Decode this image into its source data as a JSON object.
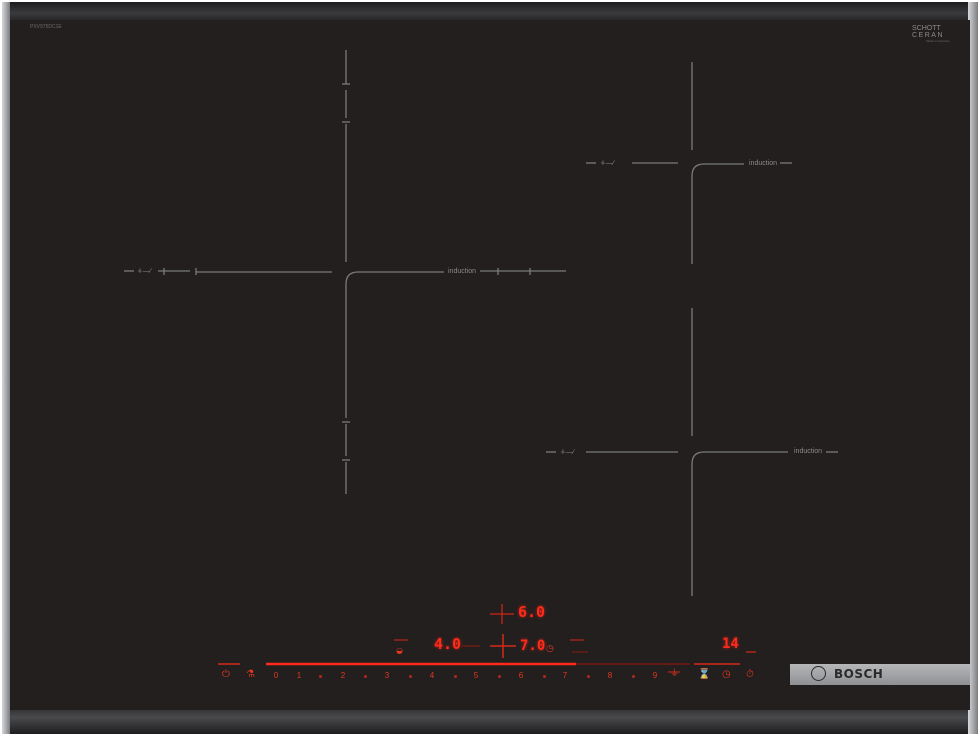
{
  "cooktop": {
    "brand": "BOSCH",
    "model_label": "PXV975DC1E",
    "glass_brand_line1": "SCHOTT",
    "glass_brand_line2": "CERAN",
    "glass_brand_line3": "Made in Germany",
    "colors": {
      "glass": "#231f1f",
      "frame": "#3a3a3c",
      "frame_highlight": "#bfc2c5",
      "markings": "#7a7a7a",
      "display_red": "#ff2a1a"
    },
    "zones": [
      {
        "name": "left-flex-zone",
        "label_left": "∔—∕",
        "label_right": "induction"
      },
      {
        "name": "right-top-zone",
        "label_left": "∔—∕",
        "label_right": "induction"
      },
      {
        "name": "right-bottom-zone",
        "label_left": "∔—∕",
        "label_right": "induction"
      }
    ],
    "displays": {
      "top": "6.0",
      "left": "4.0",
      "center": "7.0",
      "right": "14"
    },
    "slider_scale": [
      "0",
      "1",
      "2",
      "3",
      "4",
      "5",
      "6",
      "7",
      "8",
      "9"
    ],
    "icons": [
      "power-icon",
      "child-lock-icon",
      "power-boost-icon",
      "timer-icon",
      "clock-icon",
      "stopwatch-icon"
    ]
  }
}
